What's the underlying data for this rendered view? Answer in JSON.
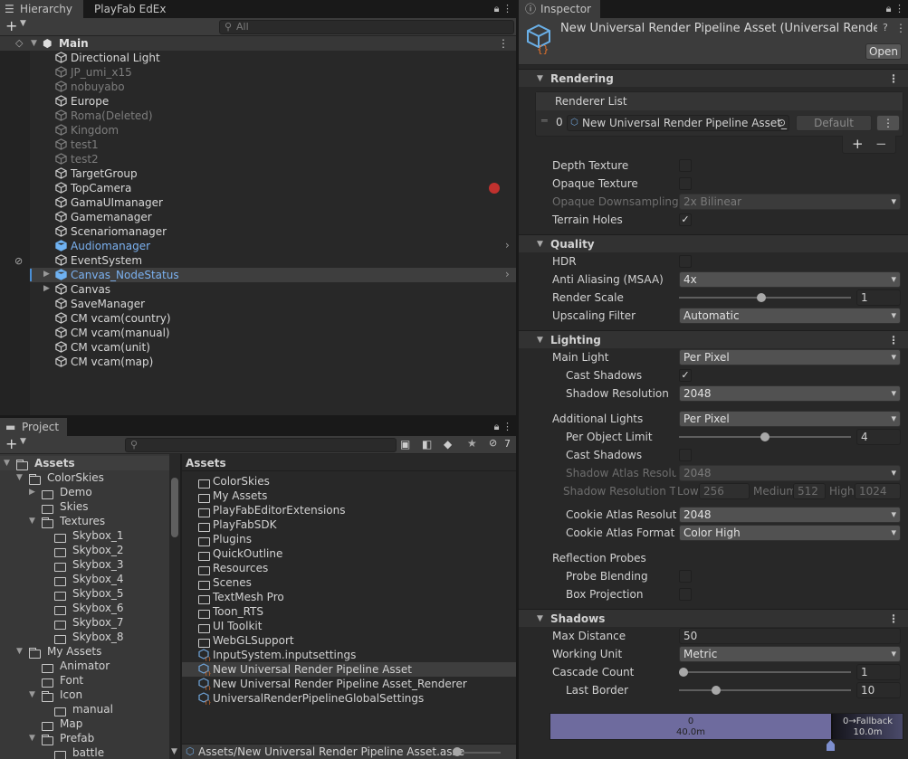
{
  "hierarchy": {
    "tabs": [
      "Hierarchy",
      "PlayFab EdEx"
    ],
    "search_placeholder": "All",
    "scene": "Main",
    "items": [
      {
        "label": "Directional Light",
        "style": "white"
      },
      {
        "label": "JP_umi_x15",
        "style": "gray"
      },
      {
        "label": "nobuyabo",
        "style": "gray"
      },
      {
        "label": "Europe",
        "style": "white"
      },
      {
        "label": "Roma(Deleted)",
        "style": "gray"
      },
      {
        "label": "Kingdom",
        "style": "gray"
      },
      {
        "label": "test1",
        "style": "gray"
      },
      {
        "label": "test2",
        "style": "gray"
      },
      {
        "label": "TargetGroup",
        "style": "white"
      },
      {
        "label": "TopCamera",
        "style": "white"
      },
      {
        "label": "GamaUImanager",
        "style": "white"
      },
      {
        "label": "Gamemanager",
        "style": "white"
      },
      {
        "label": "Scenariomanager",
        "style": "white"
      },
      {
        "label": "Audiomanager",
        "style": "blue"
      },
      {
        "label": "EventSystem",
        "style": "white"
      },
      {
        "label": "Canvas_NodeStatus",
        "style": "blue"
      },
      {
        "label": "Canvas",
        "style": "white"
      },
      {
        "label": "SaveManager",
        "style": "white"
      },
      {
        "label": "CM vcam(country)",
        "style": "white"
      },
      {
        "label": "CM vcam(manual)",
        "style": "white"
      },
      {
        "label": "CM vcam(unit)",
        "style": "white"
      },
      {
        "label": "CM vcam(map)",
        "style": "white"
      }
    ]
  },
  "project": {
    "tab": "Project",
    "hidden_count": "7",
    "tree": [
      {
        "label": "Assets",
        "depth": 0
      },
      {
        "label": "ColorSkies",
        "depth": 1
      },
      {
        "label": "Demo",
        "depth": 2
      },
      {
        "label": "Skies",
        "depth": 2
      },
      {
        "label": "Textures",
        "depth": 2
      },
      {
        "label": "Skybox_1",
        "depth": 3
      },
      {
        "label": "Skybox_2",
        "depth": 3
      },
      {
        "label": "Skybox_3",
        "depth": 3
      },
      {
        "label": "Skybox_4",
        "depth": 3
      },
      {
        "label": "Skybox_5",
        "depth": 3
      },
      {
        "label": "Skybox_6",
        "depth": 3
      },
      {
        "label": "Skybox_7",
        "depth": 3
      },
      {
        "label": "Skybox_8",
        "depth": 3
      },
      {
        "label": "My Assets",
        "depth": 1
      },
      {
        "label": "Animator",
        "depth": 2
      },
      {
        "label": "Font",
        "depth": 2
      },
      {
        "label": "Icon",
        "depth": 2
      },
      {
        "label": "manual",
        "depth": 3
      },
      {
        "label": "Map",
        "depth": 2
      },
      {
        "label": "Prefab",
        "depth": 2
      },
      {
        "label": "battle",
        "depth": 3
      }
    ],
    "breadcrumb": "Assets",
    "files": [
      {
        "label": "ColorSkies",
        "kind": "folder"
      },
      {
        "label": "My Assets",
        "kind": "folder"
      },
      {
        "label": "PlayFabEditorExtensions",
        "kind": "folder"
      },
      {
        "label": "PlayFabSDK",
        "kind": "folder"
      },
      {
        "label": "Plugins",
        "kind": "folder"
      },
      {
        "label": "QuickOutline",
        "kind": "folder"
      },
      {
        "label": "Resources",
        "kind": "folder"
      },
      {
        "label": "Scenes",
        "kind": "folder"
      },
      {
        "label": "TextMesh Pro",
        "kind": "folder"
      },
      {
        "label": "Toon_RTS",
        "kind": "folder"
      },
      {
        "label": "UI Toolkit",
        "kind": "folder"
      },
      {
        "label": "WebGLSupport",
        "kind": "folder"
      },
      {
        "label": "InputSystem.inputsettings",
        "kind": "asset"
      },
      {
        "label": "New Universal Render Pipeline Asset",
        "kind": "asset"
      },
      {
        "label": "New Universal Render Pipeline Asset_Renderer",
        "kind": "asset"
      },
      {
        "label": "UniversalRenderPipelineGlobalSettings",
        "kind": "asset"
      }
    ],
    "status_path": "Assets/New Universal Render Pipeline Asset.asse"
  },
  "inspector": {
    "tab": "Inspector",
    "title": "New Universal Render Pipeline Asset (Universal Render",
    "open_button": "Open",
    "sections": {
      "rendering": "Rendering",
      "quality": "Quality",
      "lighting": "Lighting",
      "shadows": "Shadows"
    },
    "renderer_list": {
      "header": "Renderer List",
      "index": "0",
      "value": "New Universal Render Pipeline Asset_",
      "default_button": "Default"
    },
    "rendering": {
      "depth_texture": "Depth Texture",
      "opaque_texture": "Opaque Texture",
      "opaque_downsampling": "Opaque Downsampling",
      "opaque_downsampling_value": "2x Bilinear",
      "terrain_holes": "Terrain Holes"
    },
    "quality": {
      "hdr": "HDR",
      "anti_aliasing": "Anti Aliasing (MSAA)",
      "anti_aliasing_value": "4x",
      "render_scale": "Render Scale",
      "render_scale_value": "1",
      "upscaling_filter": "Upscaling Filter",
      "upscaling_filter_value": "Automatic"
    },
    "lighting": {
      "main_light": "Main Light",
      "main_light_value": "Per Pixel",
      "cast_shadows": "Cast Shadows",
      "shadow_resolution": "Shadow Resolution",
      "shadow_resolution_value": "2048",
      "additional_lights": "Additional Lights",
      "additional_lights_value": "Per Pixel",
      "per_object_limit": "Per Object Limit",
      "per_object_limit_value": "4",
      "cast_shadows_2": "Cast Shadows",
      "shadow_atlas_resolution": "Shadow Atlas Resolut",
      "shadow_atlas_value": "2048",
      "shadow_resolution_tiers": "Shadow Resolution Ti",
      "tier_low_label": "Low",
      "tier_low": "256",
      "tier_medium_label": "Medium",
      "tier_medium": "512",
      "tier_high_label": "High",
      "tier_high": "1024",
      "cookie_atlas_resolution": "Cookie Atlas Resolutic",
      "cookie_atlas_resolution_value": "2048",
      "cookie_atlas_format": "Cookie Atlas Format",
      "cookie_atlas_format_value": "Color High",
      "reflection_probes": "Reflection Probes",
      "probe_blending": "Probe Blending",
      "box_projection": "Box Projection"
    },
    "shadows": {
      "max_distance": "Max Distance",
      "max_distance_value": "50",
      "working_unit": "Working Unit",
      "working_unit_value": "Metric",
      "cascade_count": "Cascade Count",
      "cascade_count_value": "1",
      "last_border": "Last Border",
      "last_border_value": "10",
      "cascade_index": "0",
      "cascade_distance": "40.0m",
      "fallback_label": "0→Fallback",
      "fallback_distance": "10.0m"
    }
  }
}
